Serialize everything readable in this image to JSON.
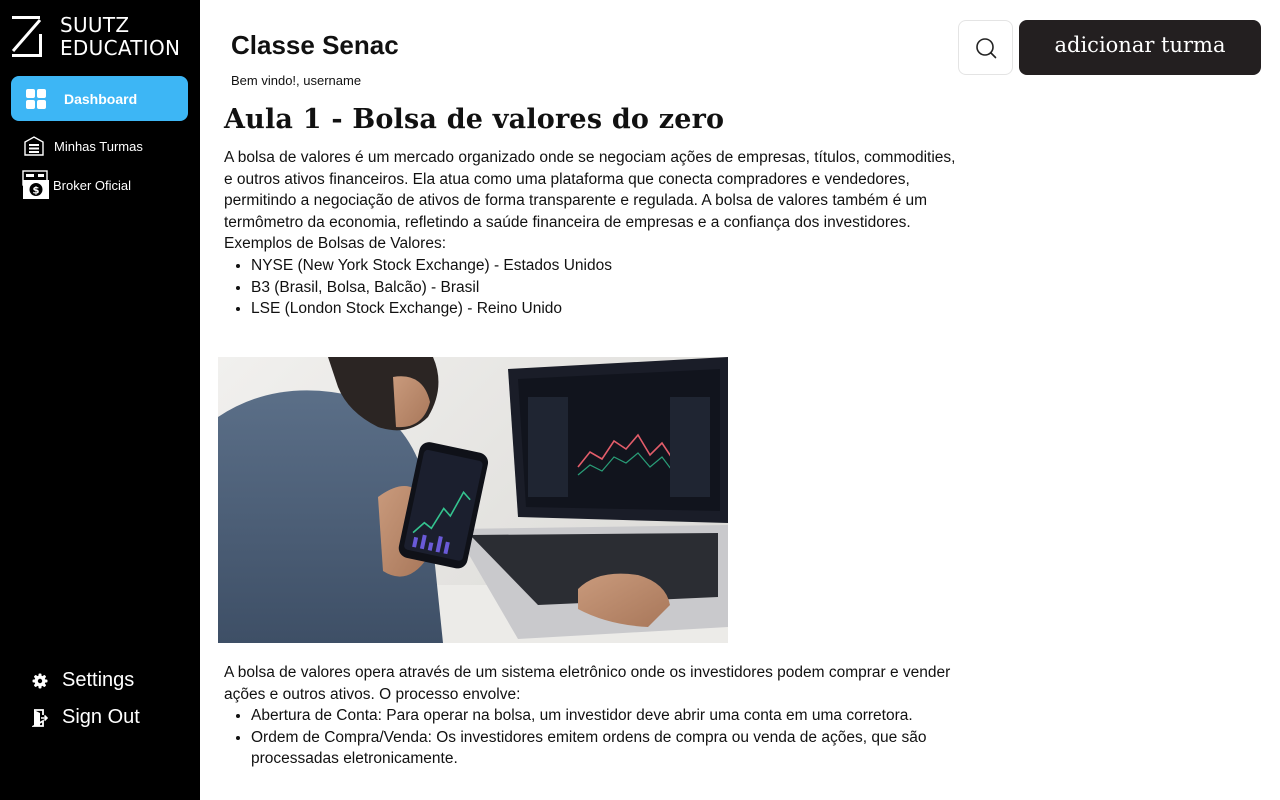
{
  "brand": {
    "line1": "SUUTZ",
    "line2": "EDUCATION"
  },
  "sidebar": {
    "active": {
      "label": "Dashboard",
      "icon": "dashboard-grid-icon"
    },
    "items": [
      {
        "label": "Minhas Turmas",
        "icon": "building-icon"
      },
      {
        "label": "Broker Oficial",
        "icon": "broker-money-icon"
      }
    ],
    "bottom": [
      {
        "label": "Settings",
        "icon": "gear-icon"
      },
      {
        "label": "Sign Out",
        "icon": "sign-out-icon"
      }
    ]
  },
  "header": {
    "title": "Classe Senac",
    "welcome": "Bem vindo!, username",
    "search_icon": "search-icon",
    "add_button": "adicionar turma"
  },
  "lesson": {
    "title": "Aula 1 - Bolsa de valores do zero",
    "intro": "A bolsa de valores é um mercado organizado onde se negociam ações de empresas, títulos, commodities, e outros ativos financeiros. Ela atua como uma plataforma que conecta compradores e vendedores, permitindo a negociação de ativos de forma transparente e regulada. A bolsa de valores também é um termômetro da economia, refletindo a saúde financeira de empresas e a confiança dos investidores.",
    "examples_heading": "Exemplos de Bolsas de Valores:",
    "examples": [
      "NYSE (New York Stock Exchange) - Estados Unidos",
      "B3 (Brasil, Bolsa, Balcão) - Brasil",
      "LSE (London Stock Exchange) - Reino Unido"
    ],
    "image_subject": "investor-with-phone-and-laptop-trading-chart",
    "process_intro": "A bolsa de valores opera através de um sistema eletrônico onde os investidores podem comprar e vender ações e outros ativos. O processo envolve:",
    "process_steps": [
      "Abertura de Conta: Para operar na bolsa, um investidor deve abrir uma conta em uma corretora.",
      "Ordem de Compra/Venda: Os investidores emitem ordens de compra ou venda de ações, que são processadas eletronicamente."
    ]
  },
  "colors": {
    "sidebar_bg": "#000000",
    "accent": "#3db6f5",
    "button_dark": "#231f20"
  }
}
